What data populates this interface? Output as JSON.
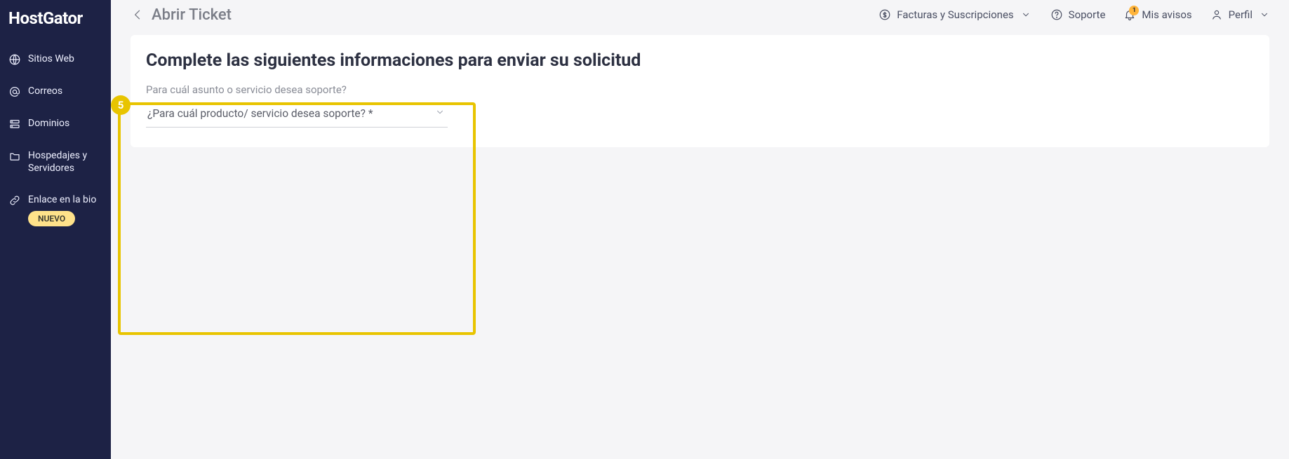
{
  "brand": "HostGator",
  "sidebar": {
    "items": [
      {
        "label": "Sitios Web"
      },
      {
        "label": "Correos"
      },
      {
        "label": "Dominios"
      },
      {
        "label": "Hospedajes y Servidores"
      },
      {
        "label": "Enlace en la bio",
        "badge": "NUEVO"
      }
    ]
  },
  "topbar": {
    "title": "Abrir Ticket",
    "actions": {
      "invoices": "Facturas y Suscripciones",
      "support": "Soporte",
      "notices": "Mis avisos",
      "notice_count": "1",
      "profile": "Perfil"
    }
  },
  "card": {
    "heading": "Complete las siguientes informaciones para enviar su solicitud",
    "step_number": "5",
    "field_label": "Para cuál asunto o servicio desea soporte?",
    "select_placeholder": "¿Para cuál producto/ servicio desea soporte? *"
  }
}
